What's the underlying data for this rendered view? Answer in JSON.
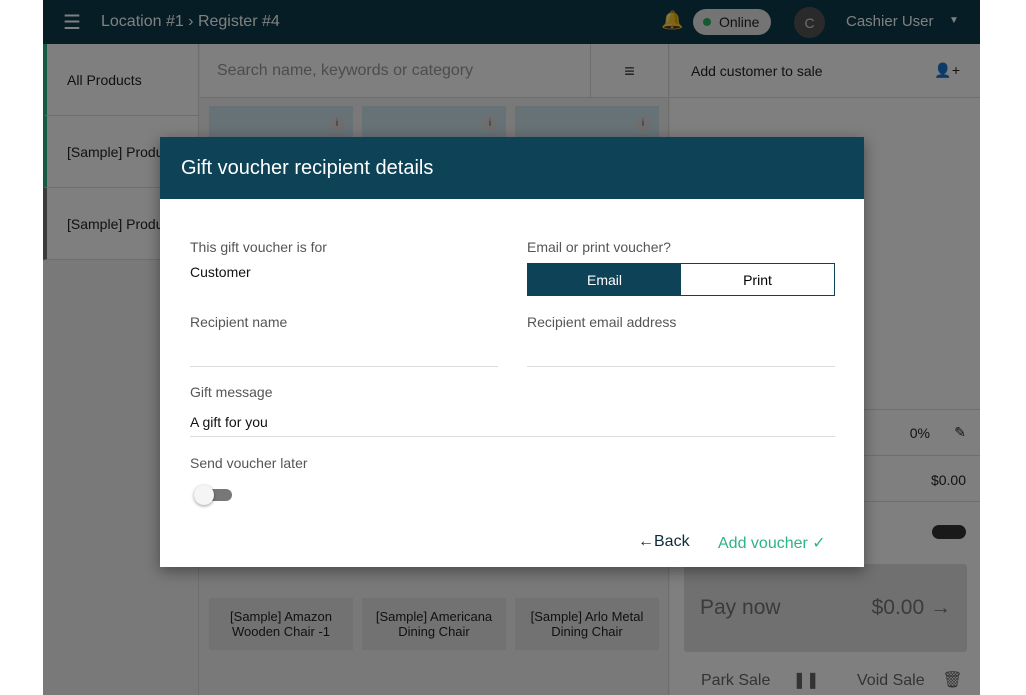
{
  "topbar": {
    "breadcrumb": "Location #1 › Register #4",
    "status": "Online",
    "avatar_initial": "C",
    "user": "Cashier User"
  },
  "sidebar": {
    "items": [
      {
        "label": "All Products"
      },
      {
        "label": "[Sample] Products"
      },
      {
        "label": "[Sample] Products"
      }
    ]
  },
  "products": {
    "search_placeholder": "Search name, keywords or category",
    "items": [
      {
        "name": "[Sample] Amazon Wooden Chair -1"
      },
      {
        "name": "[Sample] Americana Dining Chair"
      },
      {
        "name": "[Sample] Arlo Metal Dining Chair"
      }
    ]
  },
  "cart": {
    "add_customer": "Add customer to sale",
    "discount": "0%",
    "total_row": "$0.00",
    "pay_label": "Pay now",
    "pay_amount": "$0.00",
    "park": "Park Sale",
    "void": "Void Sale"
  },
  "dialog": {
    "title": "Gift voucher recipient details",
    "for_label": "This gift voucher is for",
    "for_value": "Customer",
    "method_label": "Email or print voucher?",
    "method_options": [
      "Email",
      "Print"
    ],
    "method_selected": "Email",
    "recipient_name_label": "Recipient name",
    "recipient_name": "",
    "recipient_email_label": "Recipient email address",
    "recipient_email": "",
    "message_label": "Gift message",
    "message": "A gift for you",
    "later_label": "Send voucher later",
    "later_on": false,
    "back": "←Back",
    "add": "Add voucher ✓"
  },
  "colors": {
    "primary": "#0d4257",
    "accent": "#2db38a"
  }
}
